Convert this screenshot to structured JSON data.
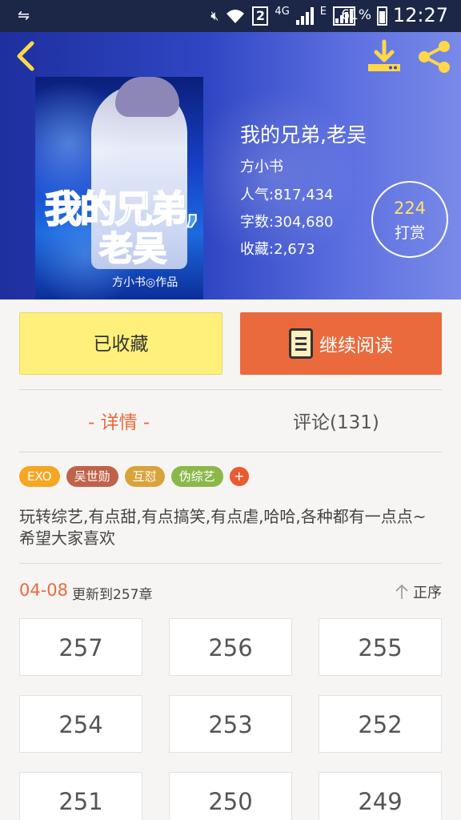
{
  "status_bar": {
    "network_type": "4G",
    "sim_slot": "2",
    "data_indicator": "E",
    "battery_percent": "61%",
    "time": "12:27"
  },
  "header": {
    "back_icon": "chevron-left-icon",
    "download_icon": "download-icon",
    "share_icon": "share-icon"
  },
  "book": {
    "cover_title_line1": "我的兄弟,",
    "cover_title_line2": "老吴",
    "cover_author": "方小书◎作品",
    "title": "我的兄弟,老吴",
    "author": "方小书",
    "popularity": "人气:817,434",
    "word_count": "字数:304,680",
    "favorites": "收藏:2,673",
    "tip_count": "224",
    "tip_label": "打赏"
  },
  "actions": {
    "favorite_label": "已收藏",
    "read_label": "继续阅读"
  },
  "tabs": {
    "detail": "- 详情 -",
    "comment": "评论(131)"
  },
  "tags": [
    {
      "label": "EXO",
      "color": "#f5a623"
    },
    {
      "label": "吴世勋",
      "color": "#c0624a"
    },
    {
      "label": "互怼",
      "color": "#d9a33b"
    },
    {
      "label": "伪综艺",
      "color": "#8ab84a"
    }
  ],
  "tag_add": "+",
  "description": "玩转综艺,有点甜,有点搞笑,有点虐,哈哈,各种都有一点点~希望大家喜欢",
  "update": {
    "date": "04-08",
    "text": "更新到257章",
    "sort_label": "正序"
  },
  "chapters": [
    "257",
    "256",
    "255",
    "254",
    "253",
    "252",
    "251",
    "250",
    "249"
  ],
  "colors": {
    "accent": "#ea6a3d",
    "favorite_bg": "#fef07a",
    "header_icon": "#ffd84a"
  }
}
